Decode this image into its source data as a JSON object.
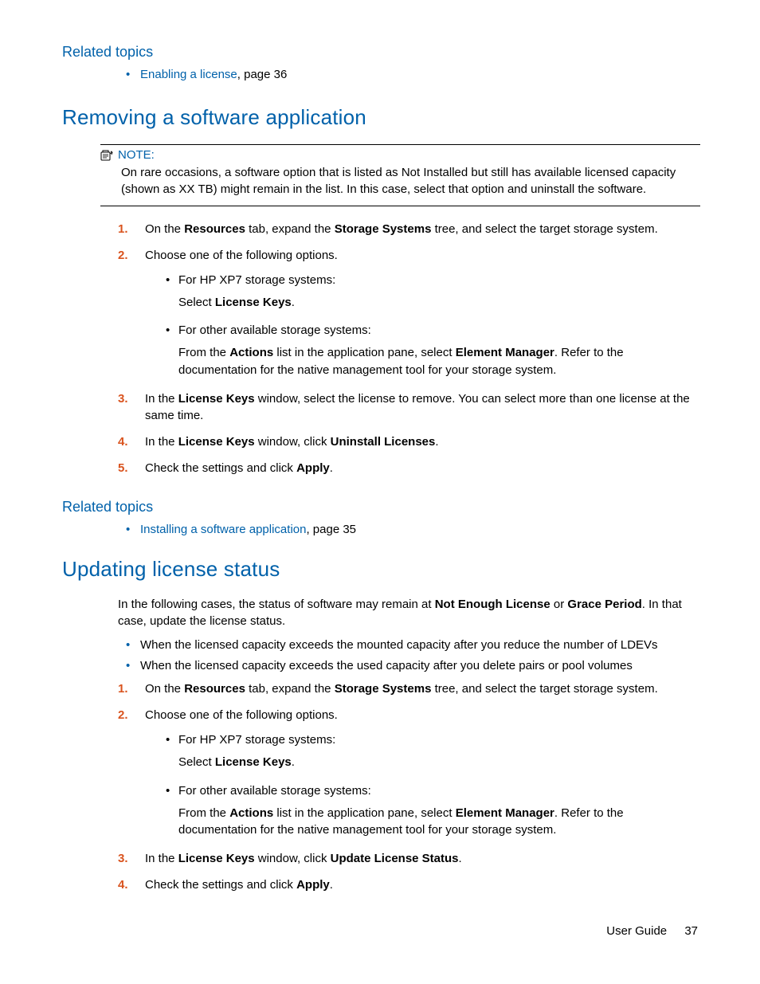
{
  "related1": {
    "heading": "Related topics",
    "item_link": "Enabling a license",
    "item_suffix": ", page 36"
  },
  "sectionA": {
    "heading": "Removing a software application",
    "note_label": "NOTE:",
    "note_body": "On rare occasions, a software option that is listed as Not Installed but still has available licensed capacity (shown as XX TB) might remain in the list. In this case, select that option and uninstall the software.",
    "s1_pre": "On the ",
    "s1_b1": "Resources",
    "s1_mid": " tab, expand the ",
    "s1_b2": "Storage Systems",
    "s1_post": " tree, and select the target storage system.",
    "s2": "Choose one of the following options.",
    "s2a_l1": "For HP XP7 storage systems:",
    "s2a_l2_pre": "Select ",
    "s2a_l2_b": "License Keys",
    "s2a_l2_post": ".",
    "s2b_l1": "For other available storage systems:",
    "s2b_l2_pre": "From the ",
    "s2b_l2_b1": "Actions",
    "s2b_l2_mid": " list in the application pane, select ",
    "s2b_l2_b2": "Element Manager",
    "s2b_l2_post": ". Refer to the documentation for the native management tool for your storage system.",
    "s3_pre": "In the ",
    "s3_b": "License Keys",
    "s3_post": " window, select the license to remove. You can select more than one license at the same time.",
    "s4_pre": "In the ",
    "s4_b1": "License Keys",
    "s4_mid": " window, click ",
    "s4_b2": "Uninstall Licenses",
    "s4_post": ".",
    "s5_pre": "Check the settings and click ",
    "s5_b": "Apply",
    "s5_post": "."
  },
  "related2": {
    "heading": "Related topics",
    "item_link": "Installing a software application",
    "item_suffix": ", page 35"
  },
  "sectionB": {
    "heading": "Updating license status",
    "intro_pre": "In the following cases, the status of software may remain at ",
    "intro_b1": "Not Enough License",
    "intro_mid": " or ",
    "intro_b2": "Grace Period",
    "intro_post": ". In that case, update the license status.",
    "bul1": "When the licensed capacity exceeds the mounted capacity after you reduce the number of LDEVs",
    "bul2": "When the licensed capacity exceeds the used capacity after you delete pairs or pool volumes",
    "s1_pre": "On the ",
    "s1_b1": "Resources",
    "s1_mid": " tab, expand the ",
    "s1_b2": "Storage Systems",
    "s1_post": " tree, and select the target storage system.",
    "s2": "Choose one of the following options.",
    "s2a_l1": "For HP XP7 storage systems:",
    "s2a_l2_pre": "Select ",
    "s2a_l2_b": "License Keys",
    "s2a_l2_post": ".",
    "s2b_l1": "For other available storage systems:",
    "s2b_l2_pre": "From the ",
    "s2b_l2_b1": "Actions",
    "s2b_l2_mid": " list in the application pane, select ",
    "s2b_l2_b2": "Element Manager",
    "s2b_l2_post": ". Refer to the documentation for the native management tool for your storage system.",
    "s3_pre": "In the ",
    "s3_b": "License Keys",
    "s3_mid": " window, click ",
    "s3_b2": "Update License Status",
    "s3_post": ".",
    "s4_pre": "Check the settings and click ",
    "s4_b": "Apply",
    "s4_post": "."
  },
  "footer": {
    "label": "User Guide",
    "page": "37"
  }
}
